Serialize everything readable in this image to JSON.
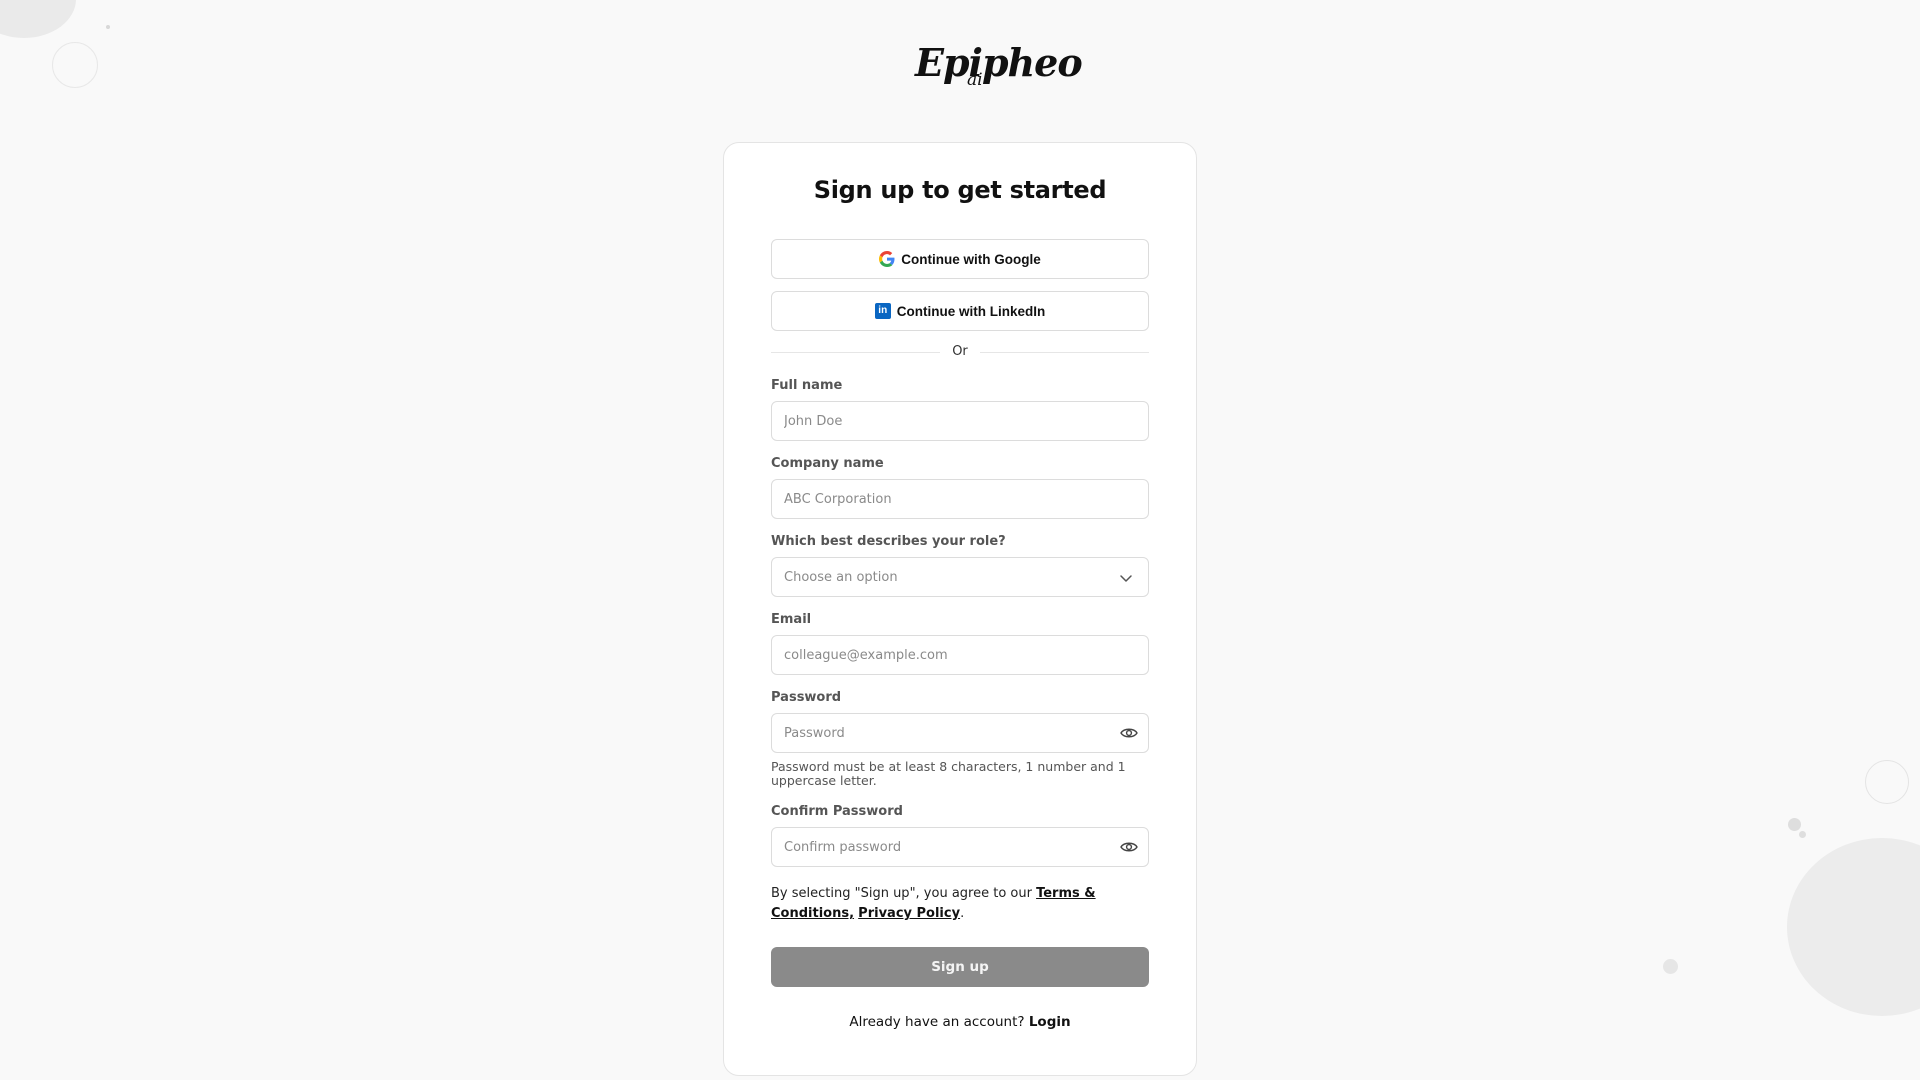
{
  "brand": {
    "logo_text": "Epipheo",
    "logo_sub": "ai"
  },
  "title": "Sign up to get started",
  "social": {
    "google_label": "Continue with Google",
    "linkedin_label": "Continue with LinkedIn",
    "linkedin_glyph": "in"
  },
  "divider_text": "Or",
  "fields": {
    "full_name": {
      "label": "Full name",
      "placeholder": "John Doe"
    },
    "company": {
      "label": "Company name",
      "placeholder": "ABC Corporation"
    },
    "role": {
      "label": "Which best describes your role?",
      "selected": "Choose an option"
    },
    "email": {
      "label": "Email",
      "placeholder": "colleague@example.com"
    },
    "password": {
      "label": "Password",
      "placeholder": "Password",
      "hint": "Password must be at least 8 characters, 1 number and 1 uppercase letter."
    },
    "confirm_password": {
      "label": "Confirm Password",
      "placeholder": "Confirm password"
    }
  },
  "agreement": {
    "prefix": "By selecting \"Sign up\", you agree to our ",
    "terms_link": "Terms & Conditions,",
    "privacy_link": "Privacy Policy",
    "suffix": "."
  },
  "submit_label": "Sign up",
  "login_prompt": {
    "text": "Already have an account?",
    "link": "Login"
  },
  "colors": {
    "page_bg": "#f9f9f9",
    "card_bg": "#ffffff",
    "button_disabled": "#8a8a8a",
    "linkedin_blue": "#0a66c2",
    "decor_grey": "#ececec"
  },
  "icons": [
    "google-icon",
    "linkedin-icon",
    "chevron-down-icon",
    "eye-icon"
  ]
}
